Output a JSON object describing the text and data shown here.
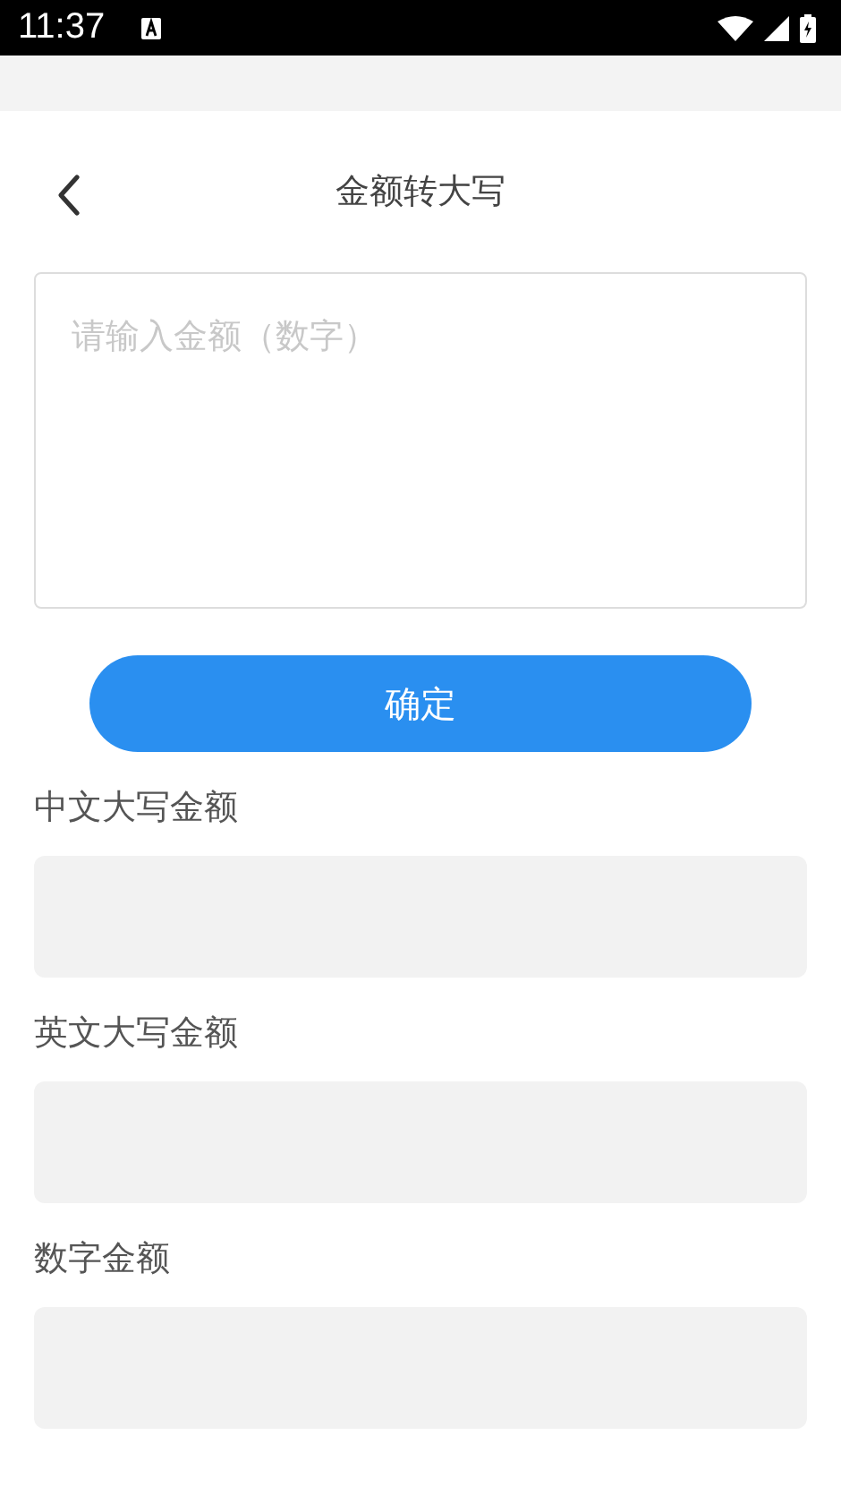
{
  "status_bar": {
    "time": "11:37"
  },
  "header": {
    "title": "金额转大写"
  },
  "input": {
    "placeholder": "请输入金额（数字）"
  },
  "confirm_button": {
    "label": "确定"
  },
  "results": [
    {
      "label": "中文大写金额"
    },
    {
      "label": "英文大写金额"
    },
    {
      "label": "数字金额"
    }
  ]
}
